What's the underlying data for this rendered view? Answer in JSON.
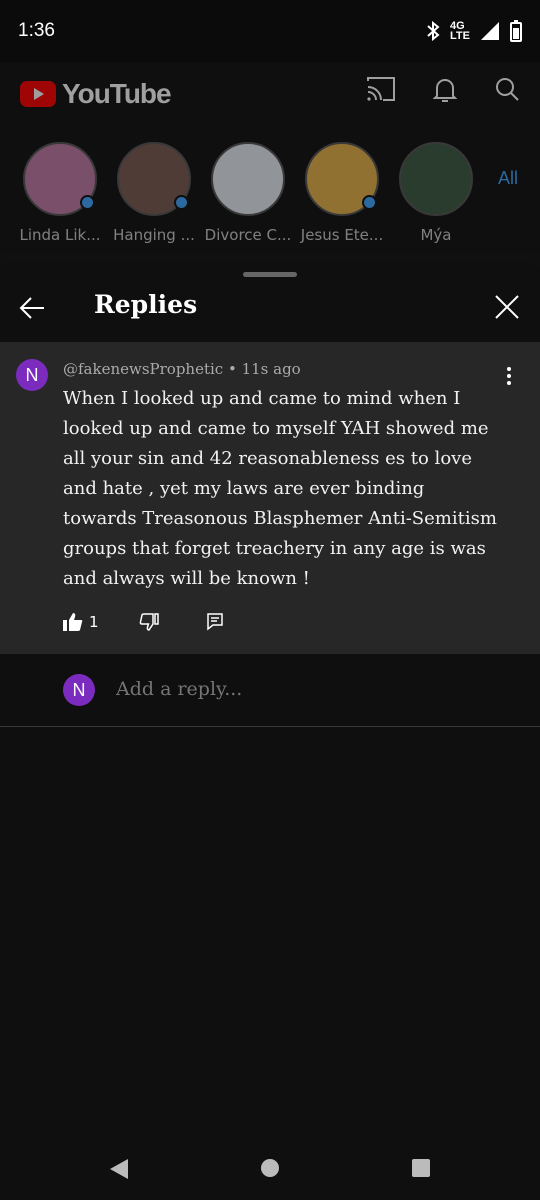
{
  "status": {
    "time": "1:36",
    "network": "4G LTE"
  },
  "youtube": {
    "brand": "YouTube",
    "subscriptions": [
      {
        "name": "Linda Lik...",
        "live_dot": true,
        "color": "#c07aa6"
      },
      {
        "name": "Hanging ...",
        "live_dot": true,
        "color": "#7a5a52"
      },
      {
        "name": "Divorce C...",
        "live_dot": false,
        "color": "#e8eef6"
      },
      {
        "name": "Jesus Ete...",
        "live_dot": true,
        "color": "#e8b24a"
      },
      {
        "name": "Mýa",
        "live_dot": false,
        "color": "#3b5a43"
      }
    ],
    "all_label": "All"
  },
  "sheet": {
    "title": "Replies",
    "comment": {
      "avatar_letter": "N",
      "author": "@fakenewsProphetic",
      "age": "11s ago",
      "meta": "@fakenewsProphetic • 11s ago",
      "text": "When I looked up and came to mind when I looked up and came to myself YAH showed me all your sin and 42 reasonableness es to love and hate , yet my laws are ever binding towards Treasonous Blasphemer Anti-Semitism groups that forget treachery in any age is was and always will be known !",
      "likes": "1"
    },
    "reply": {
      "avatar_letter": "N",
      "placeholder": "Add a reply..."
    }
  },
  "colors": {
    "accent": "#3ea6ff",
    "avatar": "#7b2cbf",
    "youtube_red": "#ff0000"
  }
}
